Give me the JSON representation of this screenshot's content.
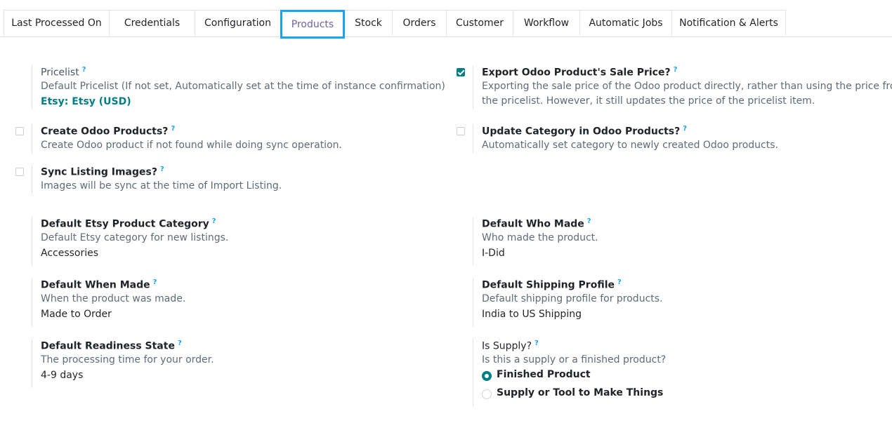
{
  "tabs": [
    {
      "label": "Last Processed On"
    },
    {
      "label": "Credentials"
    },
    {
      "label": "Configuration"
    },
    {
      "label": "Products"
    },
    {
      "label": "Stock"
    },
    {
      "label": "Orders"
    },
    {
      "label": "Customer"
    },
    {
      "label": "Workflow"
    },
    {
      "label": "Automatic Jobs"
    },
    {
      "label": "Notification & Alerts"
    }
  ],
  "active_tab": "Products",
  "help_mark": "?",
  "pricelist": {
    "label": "Pricelist",
    "desc": "Default Pricelist (If not set, Automatically set at the time of instance confirmation)",
    "value": "Etsy: Etsy (USD)"
  },
  "export_sale_price": {
    "label": "Export Odoo Product's Sale Price?",
    "desc_line1": "Exporting the sale price of the Odoo product directly, rather than using the price from",
    "desc_line2": "the pricelist. However, it still updates the price of the pricelist item.",
    "checked": true
  },
  "create_products": {
    "label": "Create Odoo Products?",
    "desc": "Create Odoo product if not found while doing sync operation.",
    "checked": false
  },
  "update_category": {
    "label": "Update Category in Odoo Products?",
    "desc": "Automatically set category to newly created Odoo products.",
    "checked": false
  },
  "sync_images": {
    "label": "Sync Listing Images?",
    "desc": "Images will be sync at the time of Import Listing.",
    "checked": false
  },
  "etsy_category": {
    "label": "Default Etsy Product Category",
    "desc": "Default Etsy category for new listings.",
    "value": "Accessories"
  },
  "who_made": {
    "label": "Default Who Made",
    "desc": "Who made the product.",
    "value": "I-Did"
  },
  "when_made": {
    "label": "Default When Made",
    "desc": "When the product was made.",
    "value": "Made to Order"
  },
  "shipping_profile": {
    "label": "Default Shipping Profile",
    "desc": "Default shipping profile for products.",
    "value": "India to US Shipping"
  },
  "readiness_state": {
    "label": "Default Readiness State",
    "desc": "The processing time for your order.",
    "value": "4-9 days"
  },
  "is_supply": {
    "label": "Is Supply?",
    "desc": "Is this a supply or a finished product?",
    "options": [
      {
        "label": "Finished Product",
        "selected": true
      },
      {
        "label": "Supply or Tool to Make Things",
        "selected": false
      }
    ]
  },
  "colors": {
    "accent": "#017e84",
    "tab_highlight": "#1aa3e8",
    "help": "#1aa3e8"
  }
}
